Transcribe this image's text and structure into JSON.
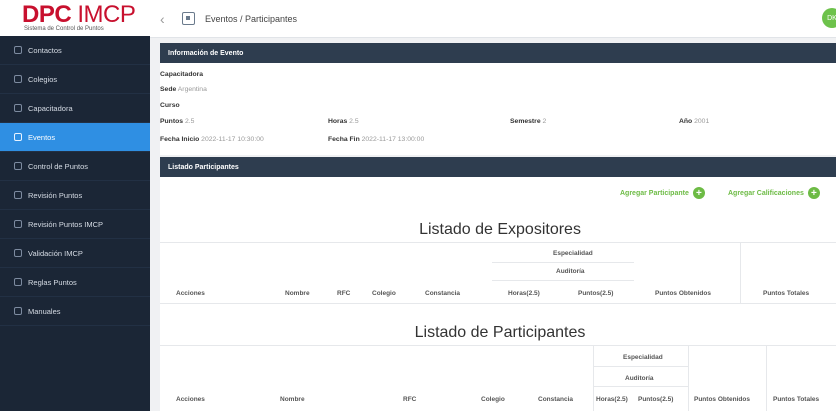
{
  "logo": {
    "title_a": "DPC",
    "title_b": "IMCP",
    "subtitle": "Sistema de Control de Puntos"
  },
  "nav": [
    {
      "label": "Contactos"
    },
    {
      "label": "Colegios"
    },
    {
      "label": "Capacitadora"
    },
    {
      "label": "Eventos"
    },
    {
      "label": "Control de Puntos"
    },
    {
      "label": "Revisión Puntos"
    },
    {
      "label": "Revisión Puntos IMCP"
    },
    {
      "label": "Validación IMCP"
    },
    {
      "label": "Reglas Puntos"
    },
    {
      "label": "Manuales"
    }
  ],
  "breadcrumb": "Eventos / Participantes",
  "avatar": "DK",
  "event": {
    "header": "Información de Evento",
    "capacitadora_label": "Capacitadora",
    "sede_label": "Sede",
    "sede_value": "Argentina",
    "curso_label": "Curso",
    "puntos_label": "Puntos",
    "puntos_value": "2.5",
    "horas_label": "Horas",
    "horas_value": "2.5",
    "semestre_label": "Semestre",
    "semestre_value": "2",
    "anio_label": "Año",
    "anio_value": "2001",
    "inicio_label": "Fecha Inicio",
    "inicio_value": "2022-11-17 10:30:00",
    "fin_label": "Fecha Fin",
    "fin_value": "2022-11-17 13:00:00"
  },
  "participants_header": "Listado Participantes",
  "buttons": {
    "add_participant": "Agregar Participante",
    "add_grades": "Agregar Calificaciones"
  },
  "expositores": {
    "title": "Listado de Expositores",
    "group_specialty": "Especialidad",
    "group_audit": "Auditoría",
    "columns": [
      "Acciones",
      "Nombre",
      "RFC",
      "Colegio",
      "Constancia",
      "Horas(2.5)",
      "Puntos(2.5)",
      "Puntos Obtenidos",
      "Puntos Totales"
    ]
  },
  "participantes": {
    "title": "Listado de Participantes",
    "group_specialty": "Especialidad",
    "group_audit": "Auditoría",
    "columns": [
      "Acciones",
      "Nombre",
      "RFC",
      "Colegio",
      "Constancia",
      "Horas(2.5)",
      "Puntos(2.5)",
      "Puntos Obtenidos",
      "Puntos Totales"
    ]
  },
  "colors": {
    "sidebar": "#1b2636",
    "active": "#2f8fe3",
    "panel_header": "#2e3d4f",
    "accent_green": "#6dbb45",
    "brand_red": "#c8102e"
  }
}
